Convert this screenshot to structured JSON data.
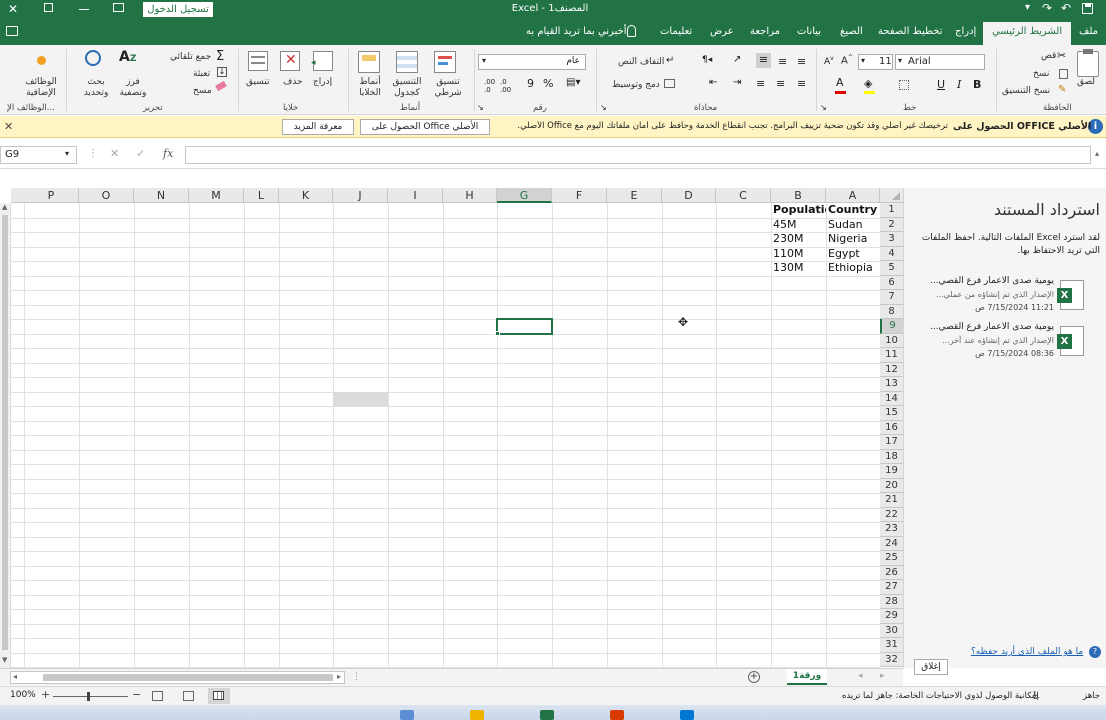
{
  "title_bar": {
    "app_title": "Excel  -  المصنف1",
    "signin_label": "تسجيل الدخول"
  },
  "ribbon_tabs": {
    "file": "ملف",
    "home": "الشريط الرئيسي",
    "insert": "إدراج",
    "page_layout": "تخطيط الصفحة",
    "formulas": "الصيغ",
    "data": "بيانات",
    "review": "مراجعة",
    "view": "عرض",
    "help": "تعليمات",
    "tell_me": "أخبرني بما تريد القيام به"
  },
  "clipboard": {
    "paste": "لصق",
    "cut": "قص",
    "copy": "نسخ",
    "format_painter": "نسخ التنسيق",
    "group_label": "الحافظة"
  },
  "font_group": {
    "font_name": "Arial",
    "font_size": "11",
    "group_label": "خط"
  },
  "alignment": {
    "wrap_text": "التفاف النص",
    "merge_center": "دمج وتوسيط",
    "group_label": "محاذاة"
  },
  "number_group": {
    "format_value": "عام",
    "percent": "%",
    "comma": "9",
    "group_label": "رقم"
  },
  "styles": {
    "conditional": "تنسيق شرطي",
    "format_table": "التنسيق كجدول",
    "cell_styles": "أنماط الخلايا",
    "group_label": "أنماط"
  },
  "cells": {
    "insert": "إدراج",
    "delete": "حذف",
    "format": "تنسيق",
    "group_label": "خلايا"
  },
  "editing": {
    "autosum": "جمع تلقائي",
    "fill": "تعبئة",
    "clear": "مسح",
    "sort_filter": "فرز وتصفية",
    "find_select": "بحث وتحديد",
    "group_label": "تحرير"
  },
  "addins": {
    "label": "الوظائف الإضافية",
    "group_label": "الوظائف الإ..."
  },
  "message_bar": {
    "title": "الحصول على OFFICE الأصلي",
    "text": "ترخيصك غير أصلي وقد تكون ضحية تزييف البرامج. تجنب انقطاع الخدمة وحافظ على أمان ملفاتك اليوم مع Office الأصلي.",
    "get_button": "الحصول على Office الأصلي",
    "learn_button": "معرفة المزيد"
  },
  "formula_bar": {
    "name_box": "G9",
    "fx": "fx",
    "value": ""
  },
  "columns": [
    "A",
    "B",
    "C",
    "D",
    "E",
    "F",
    "G",
    "H",
    "I",
    "J",
    "K",
    "L",
    "M",
    "N",
    "O",
    "P"
  ],
  "rows": [
    "1",
    "2",
    "3",
    "4",
    "5",
    "6",
    "7",
    "8",
    "9",
    "10",
    "11",
    "12",
    "13",
    "14",
    "15",
    "16",
    "17",
    "18",
    "19",
    "20",
    "21",
    "22",
    "23",
    "24",
    "25",
    "26",
    "27",
    "28",
    "29",
    "30",
    "31",
    "32"
  ],
  "cells_data": {
    "A1": "Country",
    "B1": "Population",
    "A2": "Sudan",
    "B2": "45M",
    "A3": "Nigeria",
    "B3": "230M",
    "A4": "Egypt",
    "B4": "110M",
    "A5": "Ethiopia",
    "B5": "130M"
  },
  "recovery_pane": {
    "title": "استرداد المستند",
    "description": "لقد استرد Excel الملفات التالية. احفظ الملفات التي تريد الاحتفاظ بها.",
    "files": [
      {
        "name": "يومية صدى الاعمار فرع القصي...",
        "version": "الإصدار الذي تم إنشاؤه من عملي...",
        "time": "11:21 7/15/2024 ص"
      },
      {
        "name": "يومية صدى الاعمار فرع القصي...",
        "version": "الإصدار الذي تم إنشاؤه عند آخر...",
        "time": "08:36 7/15/2024 ص"
      }
    ],
    "help_link": "ما هو الملف الذي أريد حفظه؟",
    "close_button": "إغلاق"
  },
  "sheet_tabs": {
    "active": "ورقة1"
  },
  "status_bar": {
    "ready": "جاهز",
    "accessibility": "إمكانية الوصول لذوي الاحتياجات الخاصة: جاهز لما تريده",
    "zoom": "100%"
  },
  "colors": {
    "excel_green": "#217346",
    "message_bar": "#fff5c4",
    "selection_green": "#217346"
  }
}
